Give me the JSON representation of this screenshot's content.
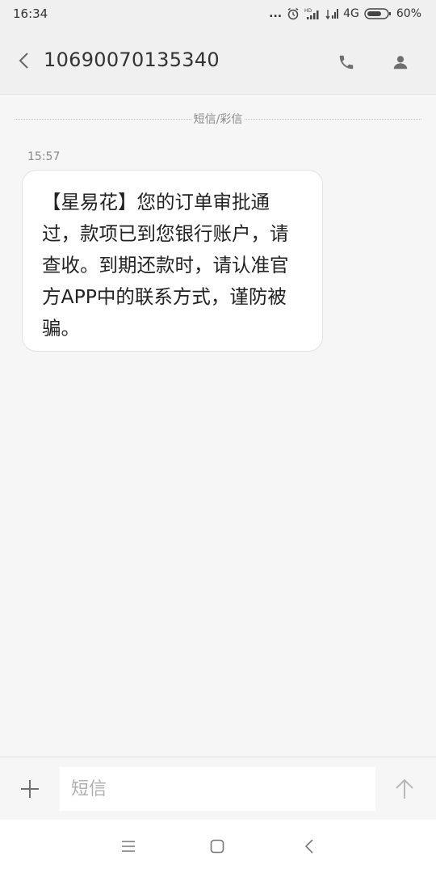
{
  "status_bar": {
    "time": "16:34",
    "more_indicator": "...",
    "network": "4G",
    "battery": "60%",
    "icons": [
      "more-icon",
      "alarm-icon",
      "hd-signal-icon",
      "signal-icon",
      "battery-icon"
    ]
  },
  "header": {
    "contact": "10690070135340",
    "icons": [
      "back-arrow-icon",
      "phone-icon",
      "person-icon"
    ]
  },
  "conversation": {
    "divider_label": "短信/彩信",
    "messages": [
      {
        "time": "15:57",
        "text": "【星易花】您的订单审批通过，款项已到您银行账户，请查收。到期还款时，请认准官方APP中的联系方式，谨防被骗。"
      }
    ]
  },
  "compose": {
    "placeholder": "短信",
    "value": "",
    "icons": [
      "plus-icon",
      "send-arrow-icon"
    ]
  },
  "nav_bar": {
    "icons": [
      "menu-icon",
      "home-square-icon",
      "back-chevron-icon"
    ]
  },
  "colors": {
    "background": "#f6f6f6",
    "bar": "#f0f0f0",
    "bubble": "#ffffff",
    "text": "#222222",
    "muted": "#8a8a8a",
    "icon": "#6f6f6f"
  }
}
